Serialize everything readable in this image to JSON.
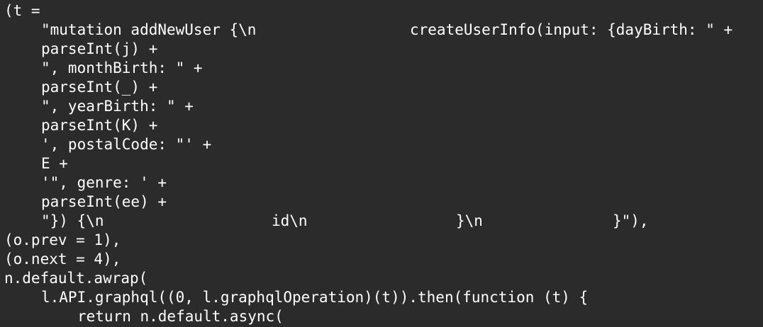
{
  "code": {
    "lines": [
      [
        "(t ="
      ],
      [
        "\"mutation addNewUser {\\n",
        "createUserInfo(input: {dayBirth: \" +"
      ],
      [
        "parseInt(j) +"
      ],
      [
        "\", monthBirth: \" +"
      ],
      [
        "parseInt(_) +"
      ],
      [
        "\", yearBirth: \" +"
      ],
      [
        "parseInt(K) +"
      ],
      [
        "', postalCode: \"' +"
      ],
      [
        "E +"
      ],
      [
        "'\", genre: ' +"
      ],
      [
        "parseInt(ee) +"
      ],
      [
        "\"}) {\\n",
        "id\\n",
        "}\\n",
        "}\"),"
      ],
      [
        "(o.prev = 1),"
      ],
      [
        "(o.next = 4),"
      ],
      [
        "n.default.awrap("
      ],
      [
        "l.API.graphql((0, l.graphqlOperation)(t)).then(function (t) {"
      ],
      [
        "return n.default.async("
      ]
    ]
  }
}
